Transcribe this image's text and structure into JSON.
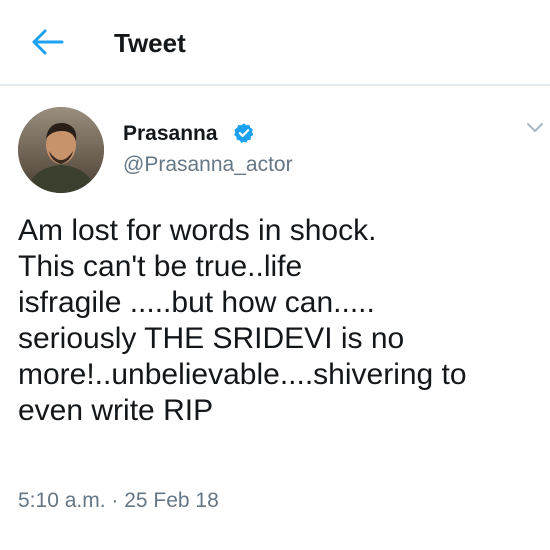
{
  "header": {
    "back_icon": "arrow-left-icon",
    "title": "Tweet",
    "accent_color": "#1da1f2"
  },
  "tweet": {
    "author": {
      "name": "Prasanna",
      "handle": "@Prasanna_actor",
      "verified_icon": "verified-badge-icon"
    },
    "menu_icon": "chevron-down-icon",
    "text_lines": [
      "Am lost for words in shock.",
      "This can't be true..life",
      "isfragile .....but how can.....",
      "seriously THE SRIDEVI is no",
      "more!..unbelievable....shivering to",
      "even write RIP"
    ],
    "timestamp": "5:10 a.m. · 25 Feb 18"
  }
}
